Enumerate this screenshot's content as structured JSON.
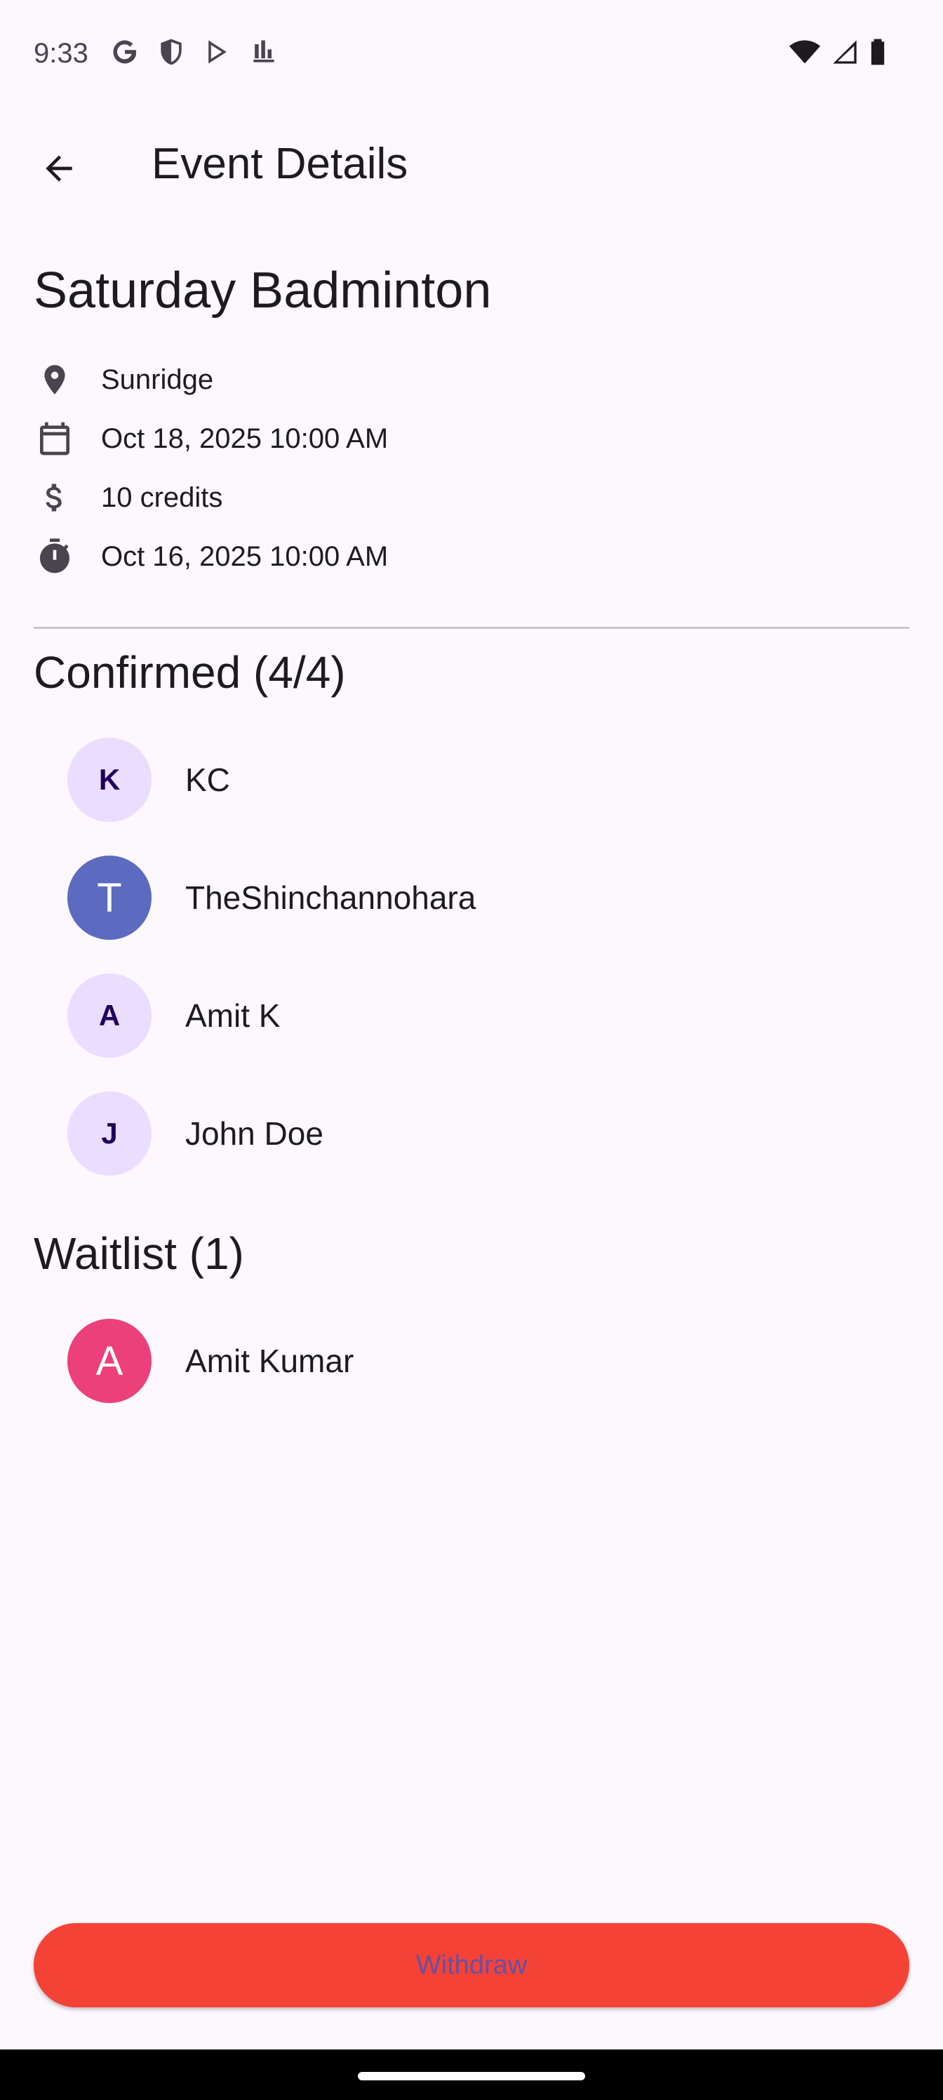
{
  "status_bar": {
    "time": "9:33"
  },
  "app_bar": {
    "title": "Event Details"
  },
  "event": {
    "title": "Saturday Badminton",
    "location": "Sunridge",
    "date": "Oct 18, 2025 10:00 AM",
    "cost": "10 credits",
    "deadline": "Oct 16, 2025 10:00 AM"
  },
  "confirmed": {
    "heading": "Confirmed (4/4)",
    "members": [
      {
        "initial": "K",
        "name": "KC",
        "avatar_color": "#EADDFF"
      },
      {
        "initial": "T",
        "name": "TheShinchannohara",
        "avatar_color": "#5C6BC0"
      },
      {
        "initial": "A",
        "name": "Amit K",
        "avatar_color": "#EADDFF"
      },
      {
        "initial": "J",
        "name": "John Doe",
        "avatar_color": "#EADDFF"
      }
    ]
  },
  "waitlist": {
    "heading": "Waitlist (1)",
    "members": [
      {
        "initial": "A",
        "name": "Amit Kumar",
        "avatar_color": "#EC407A"
      }
    ]
  },
  "actions": {
    "withdraw_label": "Withdraw",
    "withdraw_color": "#F44336"
  },
  "icons": {
    "location": "location-pin-icon",
    "date": "calendar-icon",
    "cost": "dollar-icon",
    "deadline": "timer-icon",
    "back": "arrow-back-icon"
  }
}
